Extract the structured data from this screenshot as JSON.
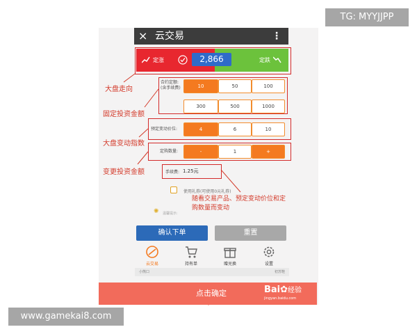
{
  "watermark_top": "TG: MYYJJPP",
  "watermark_bottom": "www.gamekai8.com",
  "header": {
    "title": "云交易",
    "close": "×",
    "menu": "⋮"
  },
  "direction": {
    "up_label": "定涨",
    "down_label": "定跌",
    "price": "2,866"
  },
  "amount": {
    "label_line1": "合约定额:",
    "label_line2": "(含手续费)",
    "options": [
      "10",
      "50",
      "100",
      "300",
      "500",
      "1000"
    ]
  },
  "change": {
    "label": "预定变动价位:",
    "options": [
      "4",
      "6",
      "10"
    ]
  },
  "quantity": {
    "label": "定购数量:",
    "minus": "-",
    "value": "1",
    "plus": "+"
  },
  "fee": {
    "label": "手续费:",
    "value": "1.25元"
  },
  "coupon": {
    "text": "使用礼券(可使用0元礼券)"
  },
  "tip": {
    "text": "温馨提示:"
  },
  "buttons": {
    "confirm": "确认下单",
    "reset": "重置"
  },
  "nav": [
    {
      "label": "云交易",
      "icon": "cloud-trade-icon"
    },
    {
      "label": "持有单",
      "icon": "cart-icon"
    },
    {
      "label": "赠兑换",
      "icon": "gift-icon"
    },
    {
      "label": "设置",
      "icon": "gear-icon"
    }
  ],
  "status": {
    "left": "小熊口",
    "right": "初苏鞋"
  },
  "annotations": {
    "trend": "大盘走向",
    "fixed_amount": "固定投资金额",
    "index": "大盘变动指数",
    "change_amount": "变更投资金额",
    "note_line1": "随看交易产品、预定变动价位和定",
    "note_line2": "购数量而变动"
  },
  "bottom_bar": {
    "text": "点击确定",
    "brand": "Bai",
    "brand_suffix": "经验",
    "brand_url": "jingyan.baidu.com"
  },
  "colors": {
    "up": "#e8272f",
    "down": "#6cc23c",
    "accent": "#f47a20",
    "confirm": "#2c6ab8",
    "annotation": "#d33a2a"
  }
}
